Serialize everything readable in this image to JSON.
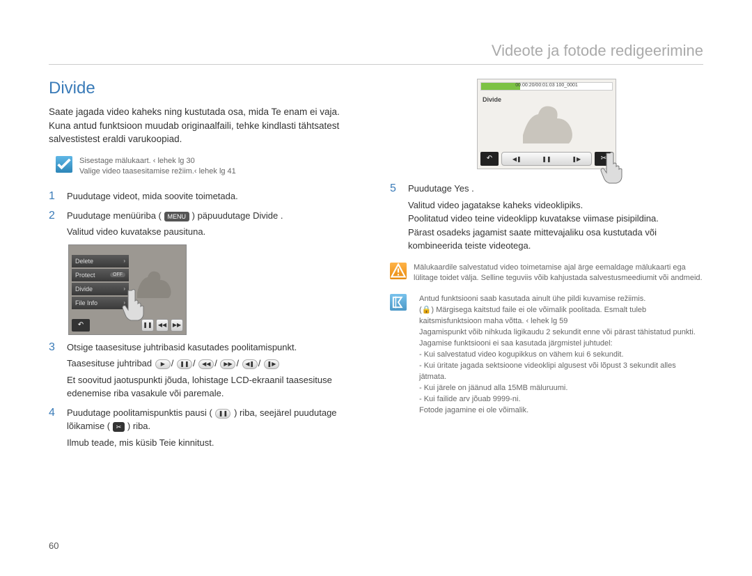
{
  "chapter": "Videote ja fotode redigeerimine",
  "section_title": "Divide",
  "intro": "Saate jagada video kaheks ning kustutada osa, mida Te enam ei vaja. Kuna antud funktsioon muudab originaalfaili, tehke kindlasti tähtsatest salvestistest eraldi varukoopiad.",
  "prereq1": "Sisestage mälukaart. ‹ lehek lg 30",
  "prereq2": "Valige video taasesitamise režiim.‹ lehek lg 41",
  "steps": {
    "s1": "Puudutage videot, mida soovite toimetada.",
    "s2a": "Puudutage menüüriba (",
    "s2b": ") päpuudutage  Divide .",
    "s2sub": "Valitud video kuvatakse pausituna.",
    "s3a": "Otsige taasesituse juhtribasid kasutades poolitamispunkt.",
    "s3sub_label": "Taasesituse juhtribad",
    "s3sub2": "Et soovitud jaotuspunkti jõuda, lohistage LCD-ekraanil taasesituse edenemise riba vasakule või paremale.",
    "s4a": "Puudutage poolitamispunktis pausi (",
    "s4b": ") riba, seejärel puudutage lõikamise (",
    "s4c": ") riba.",
    "s4sub": "Ilmub teade, mis küsib Teie kinnitust.",
    "s5": "Puudutage  Yes .",
    "s5sub": "Valitud video jagatakse kaheks videoklipiks.\nPoolitatud video teine videoklipp kuvatakse viimase pisipildina.\nPärast osadeks jagamist saate mittevajaliku osa kustutada või kombineerida teiste videotega."
  },
  "menu": {
    "delete": "Delete",
    "protect": "Protect",
    "off": "OFF",
    "divide": "Divide",
    "file_info": "File Info"
  },
  "video": {
    "label": "Divide",
    "info": "00:00:20/00:01:03   100_0001"
  },
  "warn_note": "Mälukaardile salvestatud video toimetamise ajal ärge eemaldage mälukaarti ega lülitage toidet välja. Selline teguviis võib kahjustada salvestusmeediumit või andmeid.",
  "info_note": {
    "l1": "Antud funktsiooni saab kasutada ainult ühe pildi kuvamise režiimis.",
    "l2": "(🔒) Märgisega kaitstud faile ei ole võimalik poolitada. Esmalt tuleb kaitsmisfunktsioon maha võtta.  ‹ lehek lg 59",
    "l3": "Jagamispunkt võib nihkuda ligikaudu 2 sekundit enne või pärast tähistatud punkti.",
    "l4": "Jagamise funktsiooni ei saa kasutada järgmistel juhtudel:",
    "l4a": "- Kui salvestatud video kogupikkus on vähem kui 6 sekundit.",
    "l4b": "- Kui üritate jagada sektsioone videoklipi algusest või lõpust 3 sekundit alles jätmata.",
    "l4c": "- Kui järele on jäänud alla 15MB mäluruumi.",
    "l4d": "- Kui failide arv jõuab 9999-ni.",
    "l5": "Fotode jagamine ei ole võimalik."
  },
  "menu_label": "MENU",
  "page_number": "60"
}
